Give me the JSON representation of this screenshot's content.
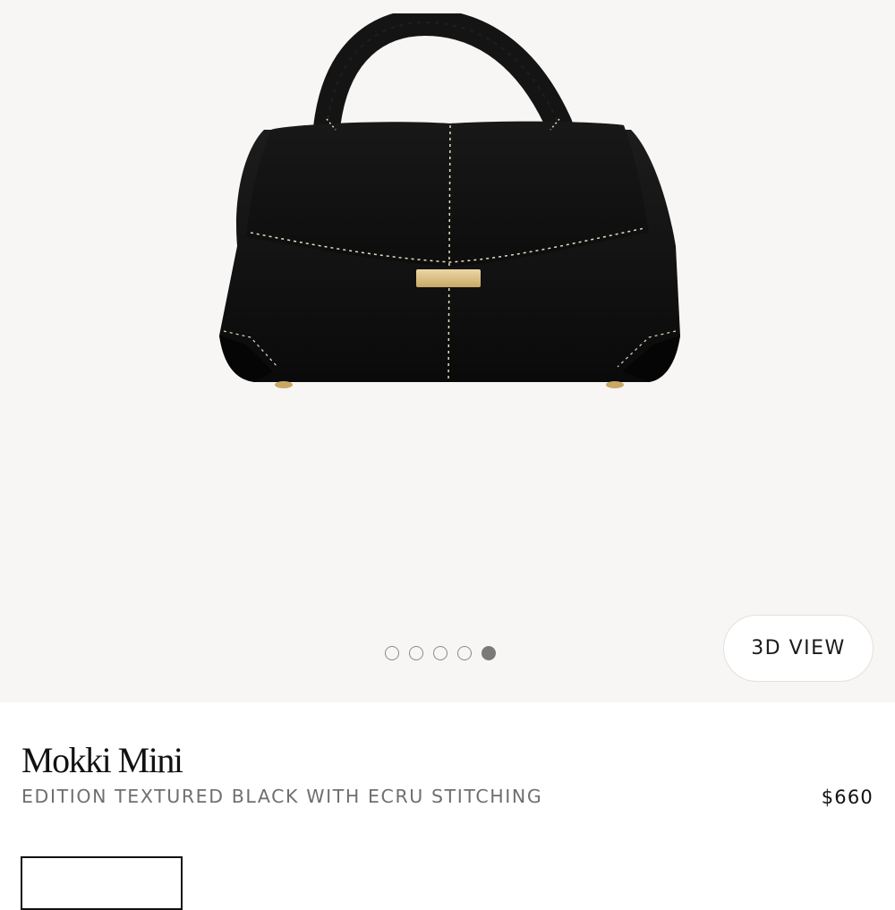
{
  "gallery": {
    "image_alt": "Mokki Mini handbag in textured black leather with ecru stitching",
    "dots_total": 5,
    "active_dot": 5,
    "view_3d_label": "3D VIEW"
  },
  "product": {
    "title": "Mokki Mini",
    "edition": "EDITION TEXTURED BLACK WITH ECRU STITCHING",
    "price": "$660"
  },
  "colors": {
    "gallery_bg": "#f7f6f4",
    "bag": "#111111",
    "stitching": "#e8dcc3",
    "hardware": "#d9bf86"
  }
}
